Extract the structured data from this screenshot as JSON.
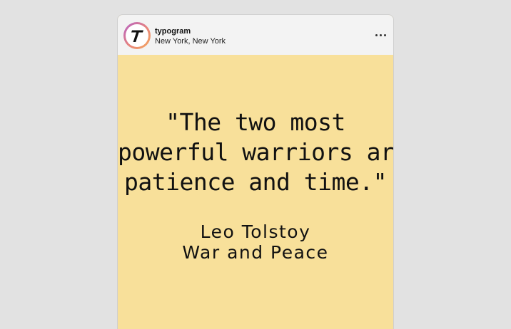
{
  "post": {
    "username": "typogram",
    "location": "New York, New York",
    "avatar_letter": "T",
    "more_icon": "more-horizontal-icon",
    "background_color": "#f8e09a",
    "quote_lines": [
      "\"The two most",
      "powerful warriors are",
      "patience and time.\""
    ],
    "author": "Leo Tolstoy",
    "book": "War and Peace"
  }
}
